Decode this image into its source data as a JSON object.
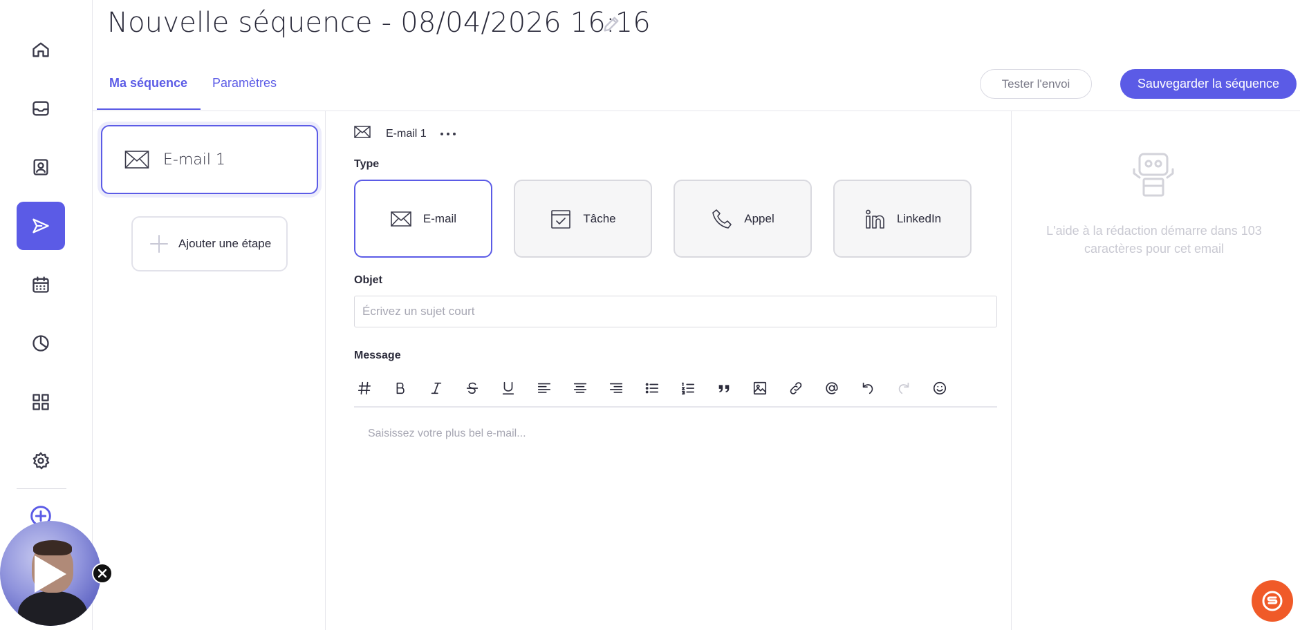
{
  "header": {
    "title": "Nouvelle séquence - 08/04/2026 16:16",
    "tabs": [
      {
        "label": "Ma séquence",
        "active": true
      },
      {
        "label": "Paramètres",
        "active": false
      }
    ],
    "test_button": "Tester l'envoi",
    "save_button": "Sauvegarder la séquence"
  },
  "sidebar": {
    "items": [
      {
        "name": "home-icon",
        "active": false
      },
      {
        "name": "inbox-icon",
        "active": false
      },
      {
        "name": "contacts-icon",
        "active": false
      },
      {
        "name": "send-icon",
        "active": true
      },
      {
        "name": "calendar-icon",
        "active": false
      },
      {
        "name": "pie-chart-icon",
        "active": false
      },
      {
        "name": "grid-icon",
        "active": false
      },
      {
        "name": "gear-icon",
        "active": false
      }
    ],
    "add_icon": "plus-circle-icon"
  },
  "steps": {
    "items": [
      {
        "label": "E-mail 1",
        "icon": "mail-icon",
        "selected": true
      }
    ],
    "add_label": "Ajouter une étape"
  },
  "editor": {
    "step_name": "E-mail 1",
    "type_label": "Type",
    "types": [
      {
        "label": "E-mail",
        "icon": "mail-icon",
        "selected": true
      },
      {
        "label": "Tâche",
        "icon": "task-icon",
        "selected": false
      },
      {
        "label": "Appel",
        "icon": "phone-icon",
        "selected": false
      },
      {
        "label": "LinkedIn",
        "icon": "linkedin-icon",
        "selected": false
      }
    ],
    "subject_label": "Objet",
    "subject_value": "",
    "subject_placeholder": "Écrivez un sujet court",
    "message_label": "Message",
    "message_placeholder": "Saisissez votre plus bel e-mail...",
    "toolbar": [
      "hash-icon",
      "bold-icon",
      "italic-icon",
      "strikethrough-icon",
      "underline-icon",
      "align-left-icon",
      "align-center-icon",
      "align-right-icon",
      "bullet-list-icon",
      "numbered-list-icon",
      "quote-icon",
      "image-icon",
      "link-icon",
      "mention-icon",
      "undo-icon",
      "redo-icon",
      "emoji-icon"
    ]
  },
  "assist": {
    "text": "L'aide à la rédaction démarre dans 103 caractères pour cet email",
    "icon": "robot-icon"
  },
  "colors": {
    "accent": "#5b5be6",
    "chat": "#f05a28"
  }
}
